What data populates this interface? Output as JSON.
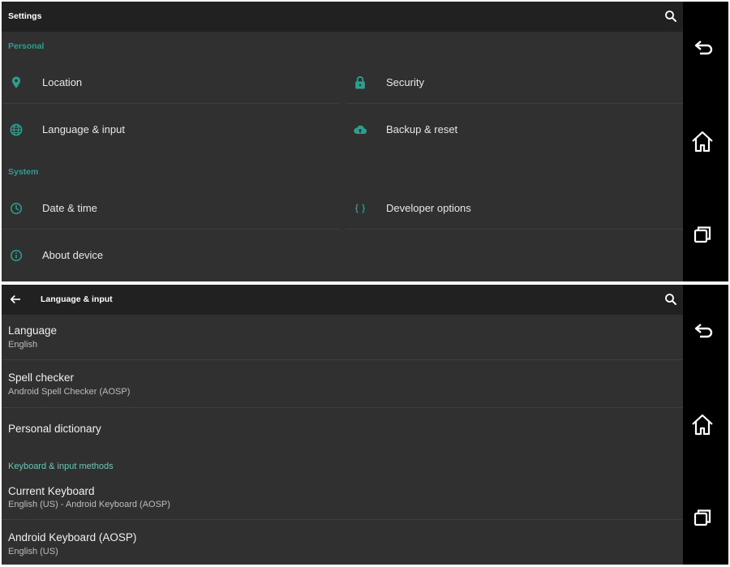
{
  "settings": {
    "title": "Settings",
    "personal_header": "Personal",
    "system_header": "System",
    "items": {
      "location": "Location",
      "security": "Security",
      "language_input": "Language & input",
      "backup_reset": "Backup & reset",
      "date_time": "Date & time",
      "developer_options": "Developer options",
      "about_device": "About device"
    }
  },
  "language_input": {
    "title": "Language & input",
    "language": {
      "title": "Language",
      "value": "English"
    },
    "spell_checker": {
      "title": "Spell checker",
      "value": "Android Spell Checker (AOSP)"
    },
    "personal_dictionary": {
      "title": "Personal dictionary"
    },
    "keyboard_header": "Keyboard & input methods",
    "current_keyboard": {
      "title": "Current Keyboard",
      "value": "English (US) - Android Keyboard (AOSP)"
    },
    "android_keyboard": {
      "title": "Android Keyboard (AOSP)",
      "value": "English (US)"
    }
  },
  "icons": {
    "search": "search-icon",
    "back_arrow": "arrow-back-icon",
    "nav_back": "nav-back-icon",
    "nav_home": "nav-home-icon",
    "nav_recents": "nav-recents-icon",
    "location": "location-pin-icon",
    "security": "lock-icon",
    "language": "globe-icon",
    "backup": "cloud-upload-icon",
    "date": "clock-icon",
    "developer": "braces-icon",
    "about": "info-icon"
  },
  "colors": {
    "accent": "#2e9e8f",
    "background": "#303030",
    "actionbar": "#212121",
    "navbar": "#000000"
  }
}
